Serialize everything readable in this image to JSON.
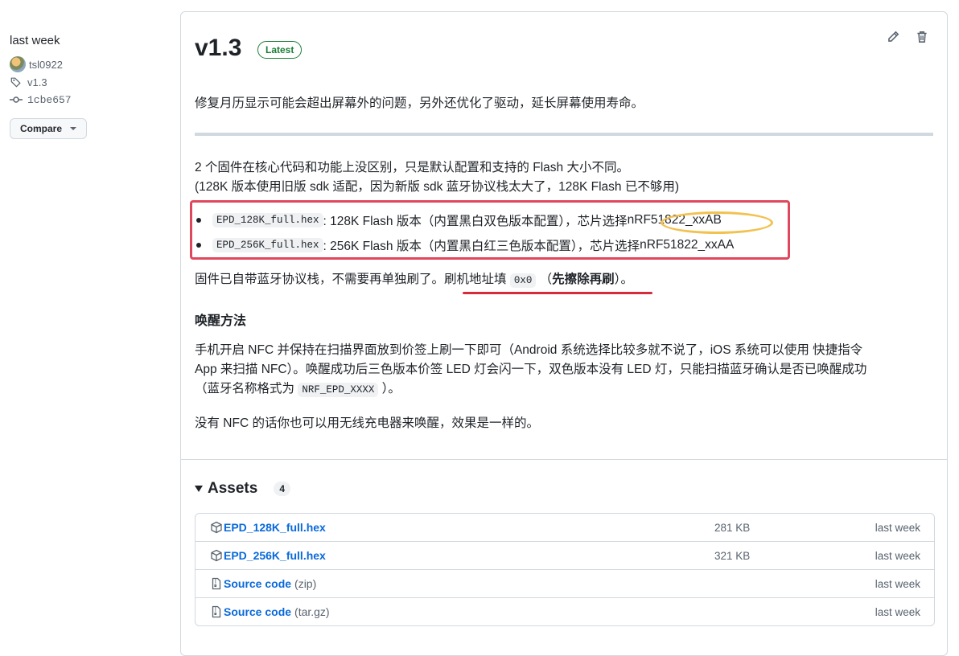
{
  "meta": {
    "when": "last week",
    "author": "tsl0922",
    "tag": "v1.3",
    "commit": "1cbe657",
    "compare_label": "Compare"
  },
  "release": {
    "title": "v1.3",
    "badge": "Latest",
    "intro": "修复月历显示可能会超出屏幕外的问题，另外还优化了驱动，延长屏幕使用寿命。",
    "p1_line1": "2 个固件在核心代码和功能上没区别，只是默认配置和支持的 Flash 大小不同。",
    "p1_line2": "(128K 版本使用旧版 sdk 适配，因为新版 sdk 蓝牙协议栈太大了，128K Flash 已不够用)",
    "items": [
      {
        "code": "EPD_128K_full.hex",
        "text": ": 128K Flash 版本（内置黑白双色版本配置），芯片选择",
        "chip": " nRF51822_xxAB"
      },
      {
        "code": "EPD_256K_full.hex",
        "text": ": 256K Flash 版本（内置黑白红三色版本配置），芯片选择",
        "chip": " nRF51822_xxAA"
      }
    ],
    "p2_pre": "固件已自带蓝牙协议栈，不需要再单独刷了。",
    "p2_addr_label": "刷机地址填 ",
    "p2_addr_code": "0x0",
    "p2_paren_open": " （",
    "p2_bold": "先擦除再刷",
    "p2_paren_close": "）",
    "p2_end": "。",
    "h_wake": "唤醒方法",
    "wake_line1": "手机开启 NFC 并保持在扫描界面放到价签上刷一下即可（Android 系统选择比较多就不说了，iOS 系统可以使用 快捷指令",
    "wake_line2": "App 来扫描 NFC）。唤醒成功后三色版本价签 LED 灯会闪一下，双色版本没有 LED 灯，只能扫描蓝牙确认是否已唤醒成功",
    "wake_line3_pre": "（蓝牙名称格式为 ",
    "wake_line3_code": "NRF_EPD_XXXX",
    "wake_line3_post": " ）。",
    "p_nfc": "没有 NFC 的话你也可以用无线充电器来唤醒，效果是一样的。"
  },
  "assets": {
    "heading": "Assets",
    "count": "4",
    "rows": [
      {
        "name": "EPD_128K_full.hex",
        "suffix": "",
        "size": "281 KB",
        "date": "last week",
        "icon": "package-icon"
      },
      {
        "name": "EPD_256K_full.hex",
        "suffix": "",
        "size": "321 KB",
        "date": "last week",
        "icon": "package-icon"
      },
      {
        "name": "Source code",
        "suffix": "(zip)",
        "size": "",
        "date": "last week",
        "icon": "file-zip-icon"
      },
      {
        "name": "Source code",
        "suffix": "(tar.gz)",
        "size": "",
        "date": "last week",
        "icon": "file-zip-icon"
      }
    ]
  },
  "colors": {
    "accent": "#0969da",
    "latest_badge": "#1a7f37",
    "highlight_box": "#e0475d",
    "highlight_oval": "#f2c14e",
    "underline": "#d62c3a"
  }
}
